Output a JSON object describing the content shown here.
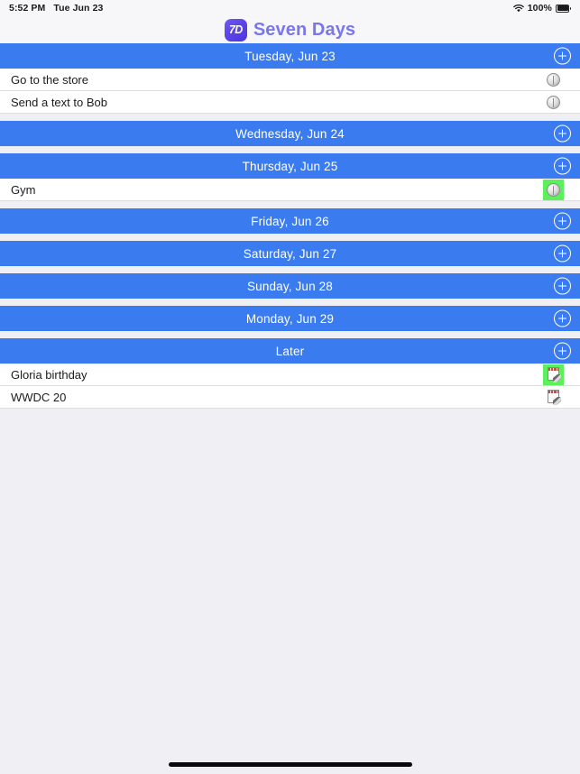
{
  "status_bar": {
    "time": "5:52 PM",
    "date": "Tue Jun 23",
    "wifi_icon": "wifi-icon",
    "battery_percent": "100%",
    "battery_icon": "battery-icon"
  },
  "header": {
    "logo_text": "7D",
    "title": "Seven Days"
  },
  "colors": {
    "section_blue": "#3b7bf0",
    "logo_purple": "#5c45e8",
    "title_purple": "#7a77e8",
    "highlight_green": "#5df05d",
    "page_background": "#f0f0f4",
    "row_background": "#ffffff"
  },
  "add_button_label": "+",
  "sections": [
    {
      "title": "Tuesday, Jun 23",
      "add_icon": "plus-circle-icon",
      "rows": [
        {
          "label": "Go to the store",
          "icon": "reminder-circle-icon",
          "highlighted": false
        },
        {
          "label": "Send a text to Bob",
          "icon": "reminder-circle-icon",
          "highlighted": false
        }
      ]
    },
    {
      "title": "Wednesday, Jun 24",
      "add_icon": "plus-circle-icon",
      "rows": []
    },
    {
      "title": "Thursday, Jun 25",
      "add_icon": "plus-circle-icon",
      "rows": [
        {
          "label": "Gym",
          "icon": "reminder-circle-icon",
          "highlighted": true
        }
      ]
    },
    {
      "title": "Friday, Jun 26",
      "add_icon": "plus-circle-icon",
      "rows": []
    },
    {
      "title": "Saturday, Jun 27",
      "add_icon": "plus-circle-icon",
      "rows": []
    },
    {
      "title": "Sunday, Jun 28",
      "add_icon": "plus-circle-icon",
      "rows": []
    },
    {
      "title": "Monday, Jun 29",
      "add_icon": "plus-circle-icon",
      "rows": []
    },
    {
      "title": "Later",
      "add_icon": "plus-circle-icon",
      "rows": [
        {
          "label": "Gloria birthday",
          "icon": "notepad-pencil-icon",
          "highlighted": true
        },
        {
          "label": "WWDC 20",
          "icon": "notepad-pencil-icon",
          "highlighted": false
        }
      ]
    }
  ]
}
